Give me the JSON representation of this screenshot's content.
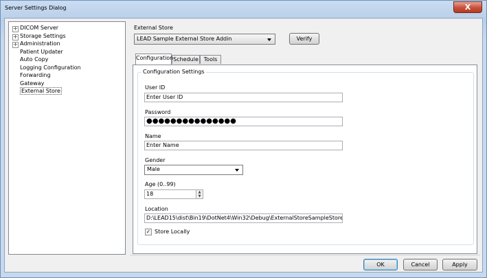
{
  "window": {
    "title": "Server Settings Dialog",
    "close_glyph": "X"
  },
  "tree": {
    "items": [
      {
        "label": "DICOM Server",
        "expander": "+",
        "indent": 0
      },
      {
        "label": "Storage Settings",
        "expander": "+",
        "indent": 0
      },
      {
        "label": "Administration",
        "expander": "+",
        "indent": 0
      },
      {
        "label": "Patient Updater",
        "expander": "",
        "indent": 1
      },
      {
        "label": "Auto Copy",
        "expander": "",
        "indent": 1
      },
      {
        "label": "Logging Configuration",
        "expander": "",
        "indent": 1
      },
      {
        "label": "Forwarding",
        "expander": "",
        "indent": 1
      },
      {
        "label": "Gateway",
        "expander": "",
        "indent": 1
      },
      {
        "label": "External Store",
        "expander": "",
        "indent": 1,
        "selected": true
      }
    ]
  },
  "external_store": {
    "label": "External Store",
    "selected": "LEAD Sample External Store Addin",
    "verify_label": "Verify"
  },
  "tabs": [
    "Configuration",
    "Schedule",
    "Tools"
  ],
  "config": {
    "group_title": "Configuration Settings",
    "user_id_label": "User ID",
    "user_id_value": "Enter User ID",
    "password_label": "Password",
    "password_value": "●●●●●●●●●●●●●●●",
    "name_label": "Name",
    "name_value": "Enter Name",
    "gender_label": "Gender",
    "gender_value": "Male",
    "age_label": "Age (0..99)",
    "age_value": "18",
    "location_label": "Location",
    "location_value": "D:\\LEAD15\\dist\\Bin19\\DotNet4\\Win32\\Debug\\ExternalStoreSampleStore",
    "store_locally_label": "Store Locally",
    "store_locally_checked": "✓"
  },
  "buttons": {
    "ok": "OK",
    "cancel": "Cancel",
    "apply": "Apply"
  }
}
